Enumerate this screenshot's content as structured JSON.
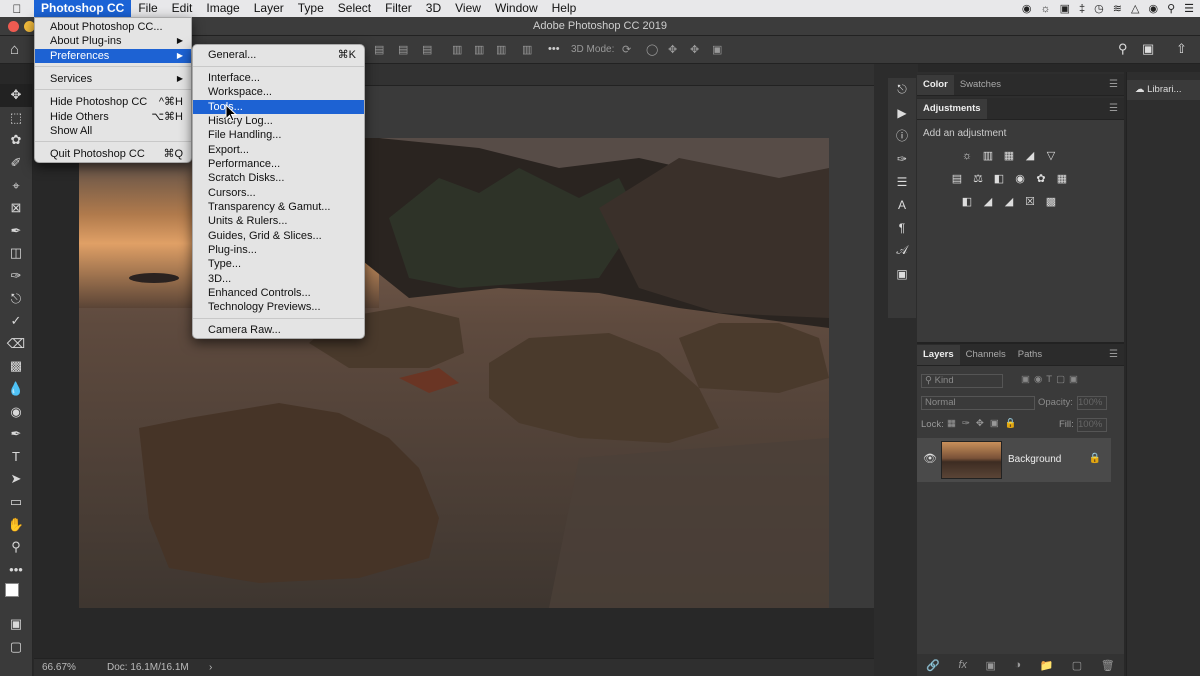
{
  "menubar": {
    "apple": "",
    "items": [
      "Photoshop CC",
      "File",
      "Edit",
      "Image",
      "Layer",
      "Type",
      "Select",
      "Filter",
      "3D",
      "View",
      "Window",
      "Help"
    ]
  },
  "window": {
    "title": "Adobe Photoshop CC 2019"
  },
  "optionsbar": {
    "mode_label": "3D Mode:"
  },
  "app_menu": {
    "items": [
      {
        "label": "About Photoshop CC..."
      },
      {
        "label": "About Plug-ins"
      },
      {
        "label": "Preferences"
      },
      {
        "label": "Services"
      },
      {
        "label": "Hide Photoshop CC",
        "shortcut": "^⌘H"
      },
      {
        "label": "Hide Others",
        "shortcut": "⌥⌘H"
      },
      {
        "label": "Show All"
      },
      {
        "label": "Quit Photoshop CC",
        "shortcut": "⌘Q"
      }
    ]
  },
  "prefs_menu": {
    "items": [
      {
        "label": "General...",
        "shortcut": "⌘K"
      },
      {
        "label": "Interface..."
      },
      {
        "label": "Workspace..."
      },
      {
        "label": "Tools..."
      },
      {
        "label": "History Log..."
      },
      {
        "label": "File Handling..."
      },
      {
        "label": "Export..."
      },
      {
        "label": "Performance..."
      },
      {
        "label": "Scratch Disks..."
      },
      {
        "label": "Cursors..."
      },
      {
        "label": "Transparency & Gamut..."
      },
      {
        "label": "Units & Rulers..."
      },
      {
        "label": "Guides, Grid & Slices..."
      },
      {
        "label": "Plug-ins..."
      },
      {
        "label": "Type..."
      },
      {
        "label": "3D..."
      },
      {
        "label": "Enhanced Controls..."
      },
      {
        "label": "Technology Previews..."
      },
      {
        "label": "Camera Raw..."
      }
    ]
  },
  "panels": {
    "color_tabs": [
      "Color",
      "Swatches"
    ],
    "adjustments_tab": "Adjustments",
    "adjustments_label": "Add an adjustment",
    "layers_tabs": [
      "Layers",
      "Channels",
      "Paths"
    ],
    "kind_placeholder": "Kind",
    "blend_mode": "Normal",
    "opacity_label": "Opacity:",
    "opacity_value": "100%",
    "lock_label": "Lock:",
    "fill_label": "Fill:",
    "fill_value": "100%",
    "layer_name": "Background",
    "libraries_tab": "Librari..."
  },
  "status": {
    "zoom": "66.67%",
    "doc": "Doc: 16.1M/16.1M",
    "arrow": "›"
  },
  "tools": [
    "move-tool",
    "marquee-tool",
    "lasso-tool",
    "quick-select-tool",
    "crop-tool",
    "frame-tool",
    "eyedropper-tool",
    "healing-tool",
    "brush-tool",
    "stamp-tool",
    "history-brush-tool",
    "eraser-tool",
    "gradient-tool",
    "blur-tool",
    "dodge-tool",
    "pen-tool",
    "type-tool",
    "path-select-tool",
    "shape-tool",
    "hand-tool",
    "zoom-tool",
    "more-tools"
  ]
}
